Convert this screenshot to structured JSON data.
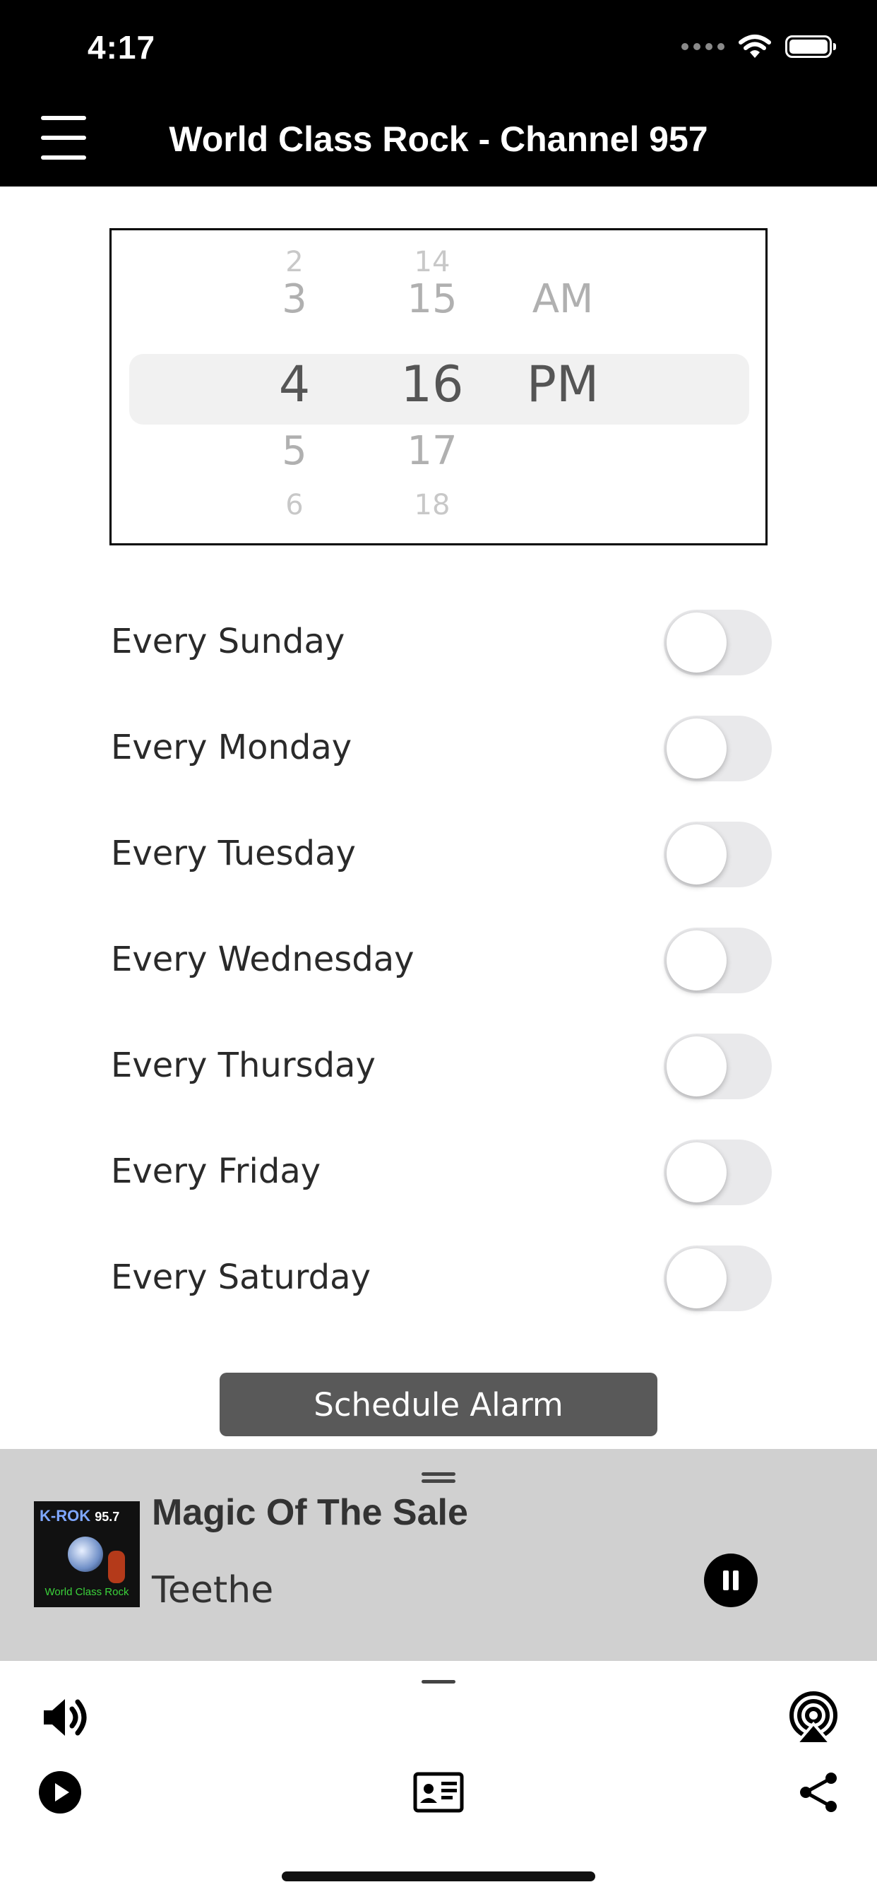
{
  "status_bar": {
    "time": "4:17"
  },
  "header": {
    "title": "World Class Rock - Channel 957"
  },
  "picker": {
    "hours": [
      "2",
      "3",
      "4",
      "5",
      "6"
    ],
    "minutes": [
      "14",
      "15",
      "16",
      "17",
      "18"
    ],
    "period_above": "AM",
    "period_selected": "PM",
    "selected": {
      "hour": "4",
      "minute": "16",
      "period": "PM"
    }
  },
  "days": [
    {
      "label": "Every Sunday",
      "on": false
    },
    {
      "label": "Every Monday",
      "on": false
    },
    {
      "label": "Every Tuesday",
      "on": false
    },
    {
      "label": "Every Wednesday",
      "on": false
    },
    {
      "label": "Every Thursday",
      "on": false
    },
    {
      "label": "Every Friday",
      "on": false
    },
    {
      "label": "Every Saturday",
      "on": false
    }
  ],
  "schedule_button": "Schedule Alarm",
  "now_playing": {
    "title": "Magic Of The Sale",
    "artist": "Teethe",
    "album_art": {
      "brand": "K-ROK",
      "number": "95.7",
      "tagline": "World Class Rock"
    },
    "state": "playing"
  },
  "controls": {
    "icons": [
      "volume-icon",
      "airplay-icon",
      "play-icon",
      "contact-card-icon",
      "share-icon"
    ]
  },
  "colors": {
    "header_bg": "#000000",
    "toggle_off": "#e9e9eb",
    "button_bg": "#595959",
    "player_bg": "#d0d0d0"
  }
}
